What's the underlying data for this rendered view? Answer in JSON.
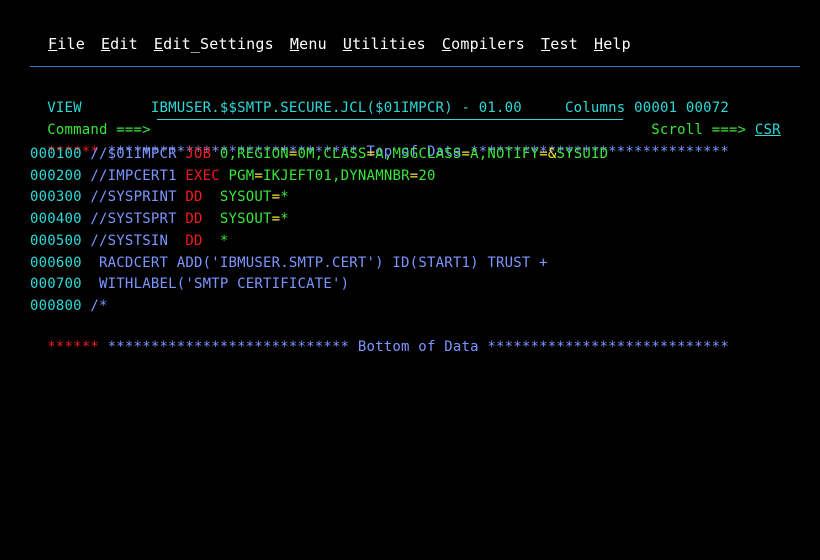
{
  "menu": [
    {
      "mnemonic": "F",
      "rest": "ile"
    },
    {
      "mnemonic": "E",
      "rest": "dit"
    },
    {
      "mnemonic": "E",
      "rest": "dit_Settings",
      "label_prefix": ""
    },
    {
      "mnemonic": "M",
      "rest": "enu"
    },
    {
      "mnemonic": "U",
      "rest": "tilities"
    },
    {
      "mnemonic": "C",
      "rest": "ompilers"
    },
    {
      "mnemonic": "T",
      "rest": "est"
    },
    {
      "mnemonic": "H",
      "rest": "elp"
    }
  ],
  "header": {
    "mode": "VIEW",
    "dataset": "IBMUSER.$$SMTP.SECURE.JCL($01IMPCR) - 01.00",
    "columns_label": "Columns",
    "columns_from": "00001",
    "columns_to": "00072",
    "command_label": "Command ===>",
    "command_value": "",
    "scroll_label": "Scroll ===>",
    "scroll_value": "CSR"
  },
  "top_marker": {
    "prefix": "******",
    "text": " ***************************** Top of Data ******************************"
  },
  "bottom_marker": {
    "prefix": "******",
    "text": " **************************** Bottom of Data ****************************"
  },
  "lines": [
    {
      "num": "000100",
      "segs": [
        {
          "t": "//$01IMPCR ",
          "c": "blue"
        },
        {
          "t": "JOB",
          "c": "red"
        },
        {
          "t": " 0,REGION",
          "c": "green"
        },
        {
          "t": "=",
          "c": "yellow"
        },
        {
          "t": "0M,CLASS",
          "c": "green"
        },
        {
          "t": "=",
          "c": "yellow"
        },
        {
          "t": "A,MSGCLASS",
          "c": "green"
        },
        {
          "t": "=",
          "c": "yellow"
        },
        {
          "t": "A,NOTIFY",
          "c": "green"
        },
        {
          "t": "=&",
          "c": "yellow"
        },
        {
          "t": "SYSUID",
          "c": "green"
        }
      ]
    },
    {
      "num": "000200",
      "segs": [
        {
          "t": "//IMPCERT1 ",
          "c": "blue"
        },
        {
          "t": "EXEC",
          "c": "red"
        },
        {
          "t": " PGM",
          "c": "green"
        },
        {
          "t": "=",
          "c": "yellow"
        },
        {
          "t": "IKJEFT01,DYNAMNBR",
          "c": "green"
        },
        {
          "t": "=",
          "c": "yellow"
        },
        {
          "t": "20",
          "c": "green"
        }
      ]
    },
    {
      "num": "000300",
      "segs": [
        {
          "t": "//SYSPRINT ",
          "c": "blue"
        },
        {
          "t": "DD",
          "c": "red"
        },
        {
          "t": "  SYSOUT",
          "c": "green"
        },
        {
          "t": "=",
          "c": "yellow"
        },
        {
          "t": "*",
          "c": "green"
        }
      ]
    },
    {
      "num": "000400",
      "segs": [
        {
          "t": "//SYSTSPRT ",
          "c": "blue"
        },
        {
          "t": "DD",
          "c": "red"
        },
        {
          "t": "  SYSOUT",
          "c": "green"
        },
        {
          "t": "=",
          "c": "yellow"
        },
        {
          "t": "*",
          "c": "green"
        }
      ]
    },
    {
      "num": "000500",
      "segs": [
        {
          "t": "//SYSTSIN  ",
          "c": "blue"
        },
        {
          "t": "DD",
          "c": "red"
        },
        {
          "t": "  *",
          "c": "green"
        }
      ]
    },
    {
      "num": "000600",
      "segs": [
        {
          "t": " RACDCERT ADD('IBMUSER.SMTP.CERT') ID(START1) TRUST +",
          "c": "blue"
        }
      ]
    },
    {
      "num": "000700",
      "segs": [
        {
          "t": " WITHLABEL('SMTP CERTIFICATE')",
          "c": "blue"
        }
      ]
    },
    {
      "num": "000800",
      "segs": [
        {
          "t": "/*",
          "c": "blue"
        }
      ]
    }
  ]
}
